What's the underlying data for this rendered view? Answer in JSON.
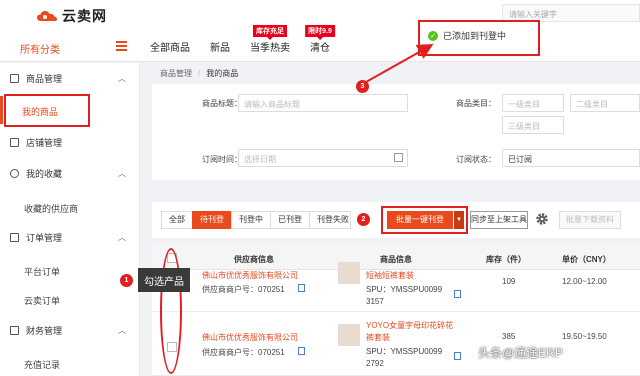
{
  "brand": {
    "name": "云卖网"
  },
  "header": {
    "search_placeholder": "请输入关键字",
    "all_categories": "所有分类",
    "nav": [
      {
        "label": "全部商品",
        "tag": ""
      },
      {
        "label": "新品",
        "tag": ""
      },
      {
        "label": "当季热卖",
        "tag": "库存充足"
      },
      {
        "label": "清仓",
        "tag": "限时9.9"
      }
    ],
    "toast": "已添加到刊登中"
  },
  "sidebar": {
    "groups": [
      {
        "label": "商品管理",
        "icon": "box-icon"
      },
      {
        "label": "店铺管理",
        "icon": "store-icon"
      },
      {
        "label": "我的收藏",
        "icon": "star-icon"
      },
      {
        "label": "订单管理",
        "icon": "order-icon"
      },
      {
        "label": "财务管理",
        "icon": "finance-icon"
      }
    ],
    "items": {
      "my_products": "我的商品",
      "fav_suppliers": "收藏的供应商",
      "platform_orders": "平台订单",
      "yunmai_orders": "云卖订单",
      "recharge": "充值记录"
    }
  },
  "breadcrumb": {
    "root": "商品管理",
    "current": "我的商品"
  },
  "filters": {
    "title_label": "商品标题：",
    "title_placeholder": "请输入商品标题",
    "category_label": "商品类目：",
    "cat1": "一级类目",
    "cat2": "二级类目",
    "cat3": "三级类目",
    "time_label": "订阅时间：",
    "time_placeholder": "选择日期",
    "status_label": "订阅状态：",
    "status_value": "已订阅"
  },
  "toolbar": {
    "tabs": [
      "全部",
      "待刊登",
      "刊登中",
      "已刊登",
      "刊登失败"
    ],
    "active_tab": 1,
    "bulk_publish": "批量一键刊登",
    "sync": "同步至上架工具",
    "download": "批量下载资料"
  },
  "table": {
    "headers": {
      "supplier": "供应商信息",
      "product": "商品信息",
      "stock": "库存（件）",
      "price": "单价（CNY）"
    },
    "rows": [
      {
        "supplier": "佛山市优优秀服饰有限公司",
        "supplier_id": "供应商商户号：070251",
        "product": "短袖短裤套装",
        "spu": "SPU：YMSSPU0099",
        "spu2": "3157",
        "stock": "109",
        "price": "12.00~12.00"
      },
      {
        "supplier": "佛山市优优秀服饰有限公司",
        "supplier_id": "供应商商户号：070251",
        "product": "YOYO女童字母印花碎花",
        "product2": "裤套装",
        "spu": "SPU：YMSSPU0099",
        "spu2": "2792",
        "stock": "385",
        "price": "19.50~19.50"
      }
    ]
  },
  "annotations": {
    "step1": "1",
    "step2": "2",
    "step3": "3",
    "callout": "勾选产品"
  },
  "watermark": "头条@通途ERP",
  "colors": {
    "accent": "#e8491d",
    "highlight": "#e02020",
    "success": "#52c41a"
  }
}
